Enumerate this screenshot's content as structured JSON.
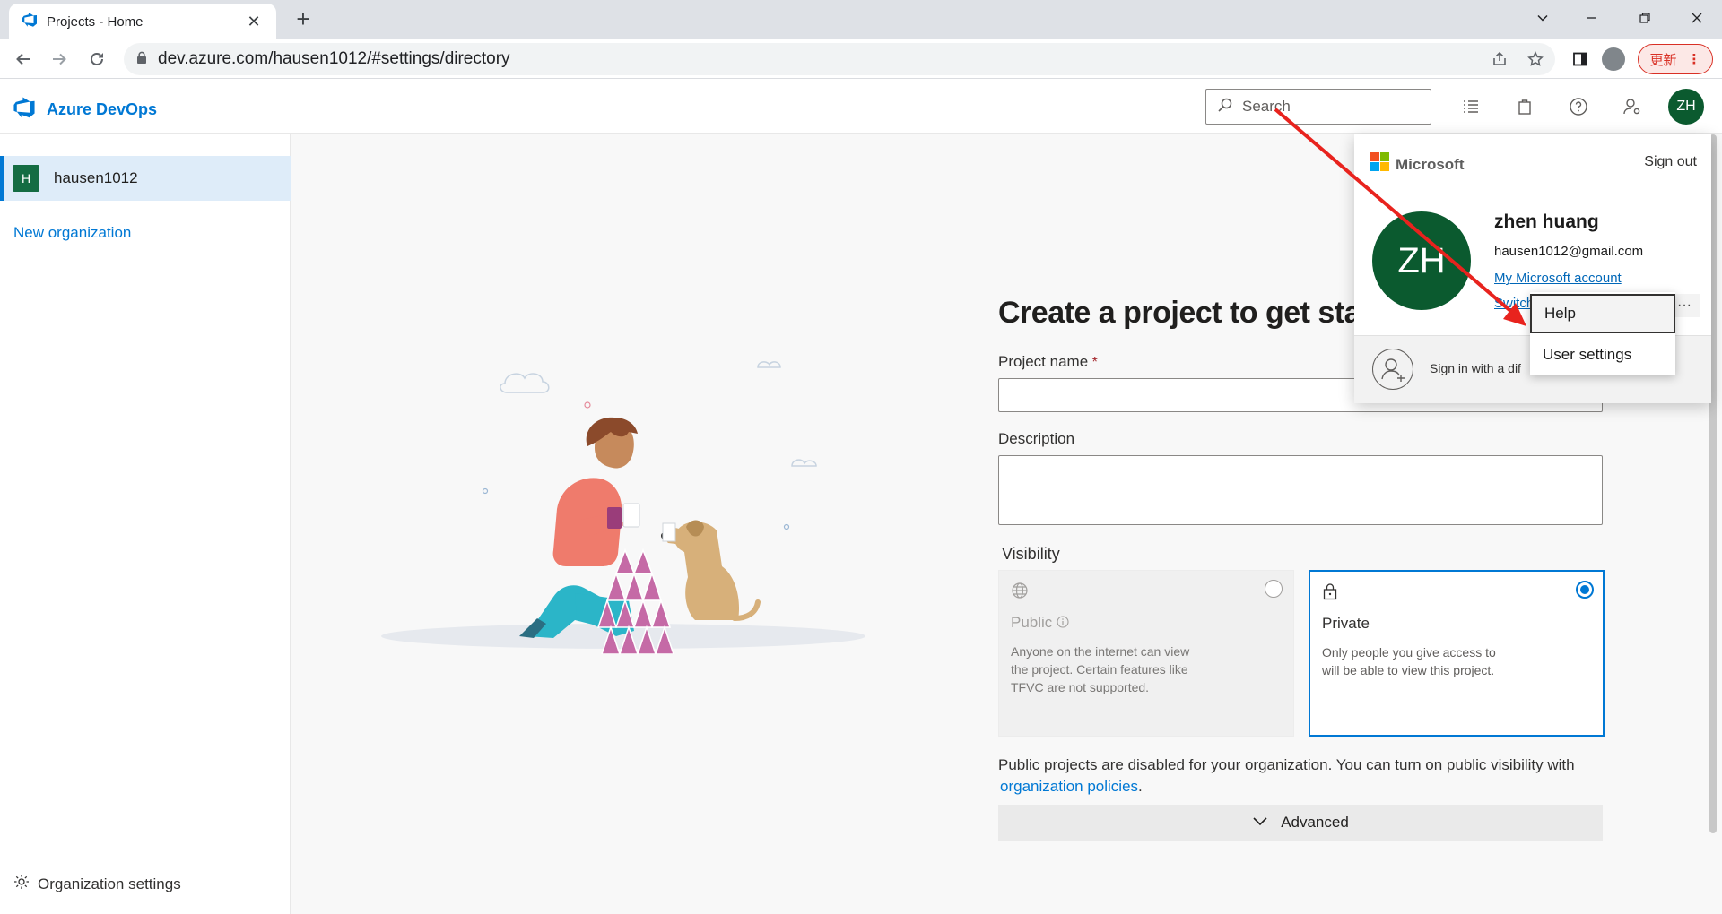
{
  "browser": {
    "tab_title": "Projects - Home",
    "url": "dev.azure.com/hausen1012/#settings/directory",
    "update_label": "更新"
  },
  "header": {
    "brand": "Azure DevOps",
    "search_placeholder": "Search",
    "avatar_initials": "ZH"
  },
  "sidebar": {
    "org_initial": "H",
    "org_name": "hausen1012",
    "new_org": "New organization",
    "org_settings": "Organization settings"
  },
  "form": {
    "title": "Create a project to get started",
    "project_name_label": "Project name",
    "required_mark": "*",
    "description_label": "Description",
    "visibility_label": "Visibility",
    "public_title": "Public",
    "public_desc": "Anyone on the internet can view the project. Certain features like TFVC are not supported.",
    "private_title": "Private",
    "private_desc": "Only people you give access to will be able to view this project.",
    "selected": "Private",
    "note": "Public projects are disabled for your organization. You can turn on public visibility with",
    "note_link": "organization policies",
    "note_end": ".",
    "advanced": "Advanced"
  },
  "account_flyout": {
    "brand": "Microsoft",
    "sign_out": "Sign out",
    "initials": "ZH",
    "name": "zhen huang",
    "email": "hausen1012@gmail.com",
    "ms_account_link": "My Microsoft account",
    "switch_link": "Switch",
    "more": "···",
    "sign_in_other": "Sign in with a dif"
  },
  "context_menu": {
    "items": [
      "Help",
      "User settings"
    ]
  },
  "colors": {
    "accent": "#0078d4",
    "avatar": "#0b5a2f",
    "annotation_arrow": "#e8231e"
  }
}
